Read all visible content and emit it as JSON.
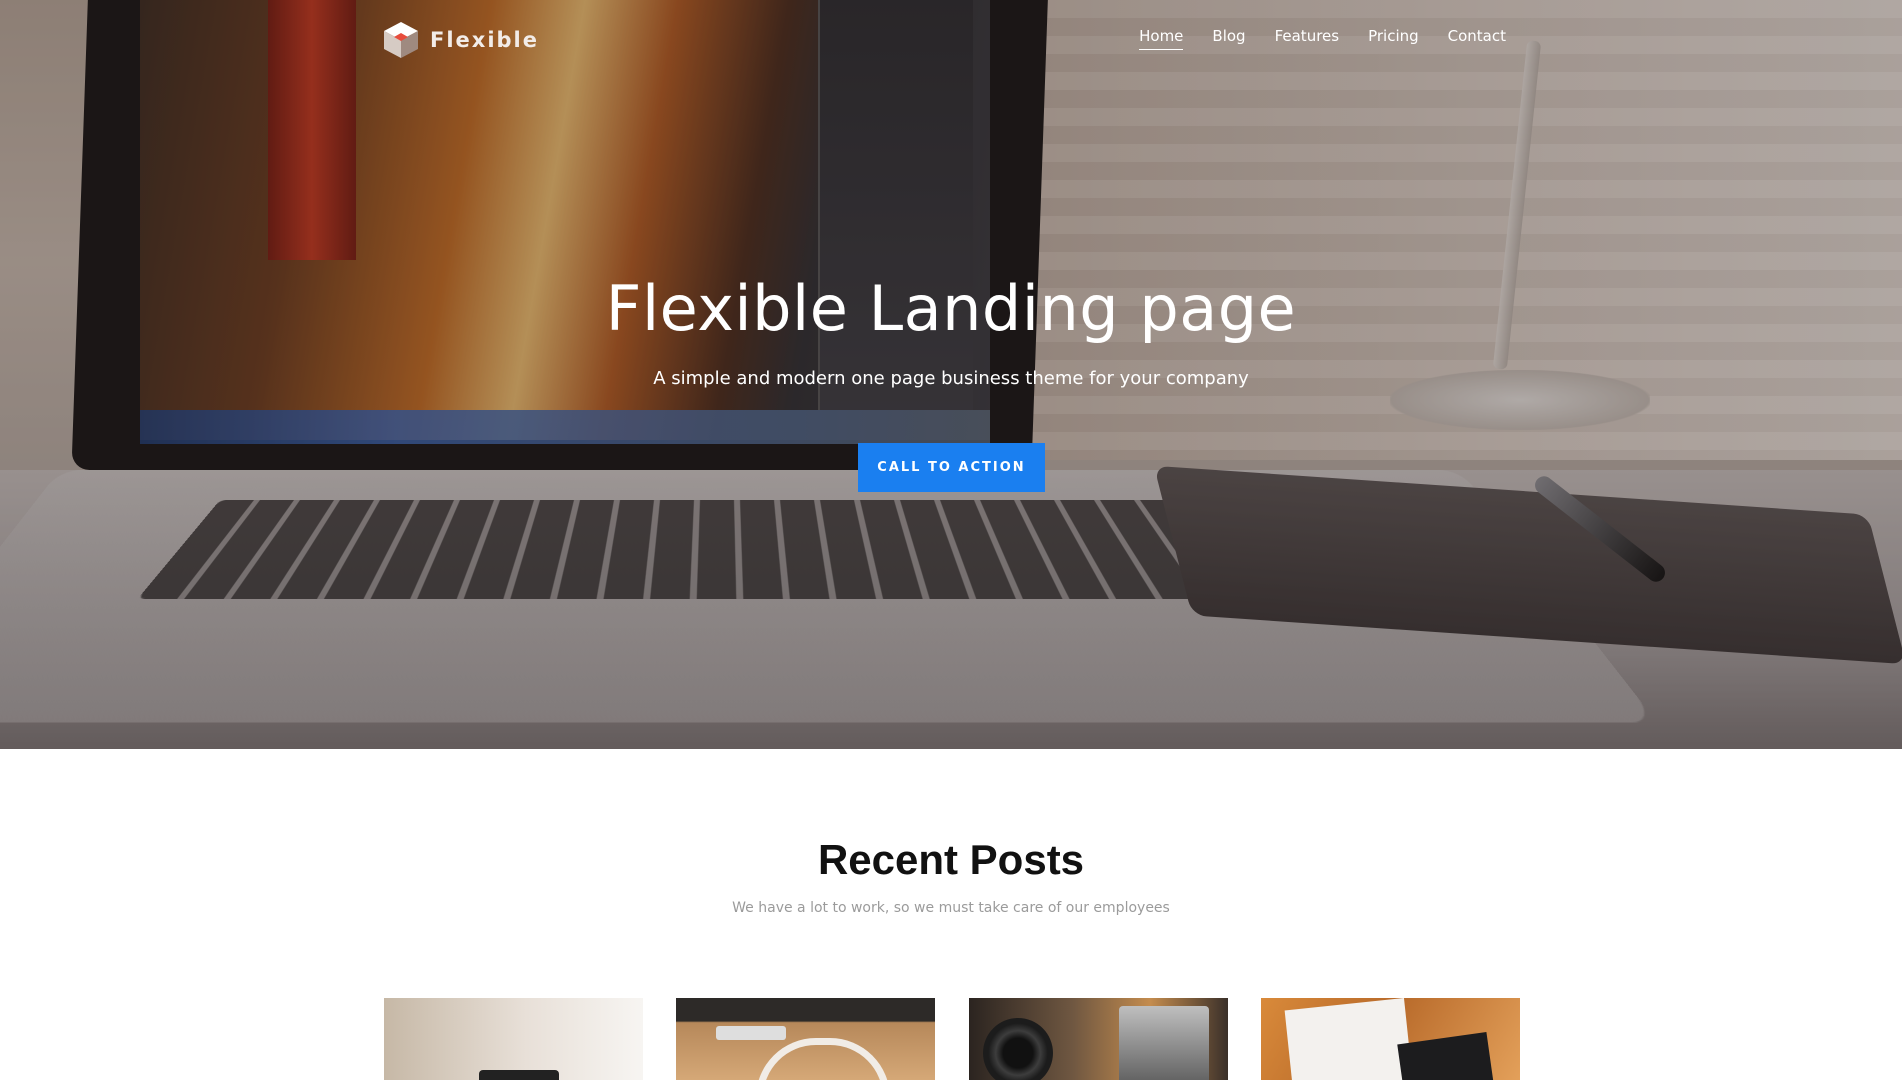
{
  "brand": {
    "name": "Flexible"
  },
  "nav": {
    "items": [
      {
        "label": "Home",
        "active": true
      },
      {
        "label": "Blog",
        "active": false
      },
      {
        "label": "Features",
        "active": false
      },
      {
        "label": "Pricing",
        "active": false
      },
      {
        "label": "Contact",
        "active": false
      }
    ]
  },
  "hero": {
    "title": "Flexible Landing page",
    "subtitle": "A simple and modern one page business theme for your company",
    "cta_label": "CALL TO ACTION"
  },
  "recent_posts": {
    "title": "Recent Posts",
    "subtitle": "We have a lot to work, so we must take care of our employees",
    "posts": [
      {
        "image": "blurred-desk-photo"
      },
      {
        "image": "wooden-desk-chair-photo"
      },
      {
        "image": "vintage-cameras-photo"
      },
      {
        "image": "magazine-on-table-photo"
      }
    ]
  },
  "colors": {
    "accent": "#1a7ff0",
    "text_dark": "#111111",
    "text_muted": "#9b9b9b"
  }
}
